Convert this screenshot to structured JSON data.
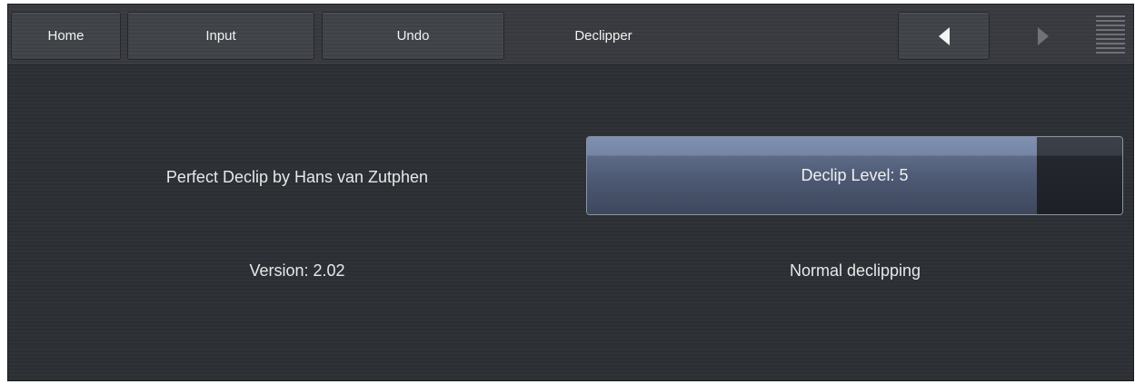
{
  "nav": {
    "home": "Home",
    "input": "Input",
    "undo": "Undo",
    "current": "Declipper",
    "prev_icon": "arrow-left-icon",
    "next_icon": "arrow-right-icon",
    "menu_icon": "menu-icon"
  },
  "info": {
    "title": "Perfect Declip by Hans van Zutphen",
    "version": "Version: 2.02"
  },
  "declip": {
    "level_label": "Declip Level: 5",
    "level_fraction": 0.84,
    "mode": "Normal declipping"
  },
  "colors": {
    "background": "#34363b",
    "accent": "#7585a5",
    "text": "#e8e8e8"
  }
}
